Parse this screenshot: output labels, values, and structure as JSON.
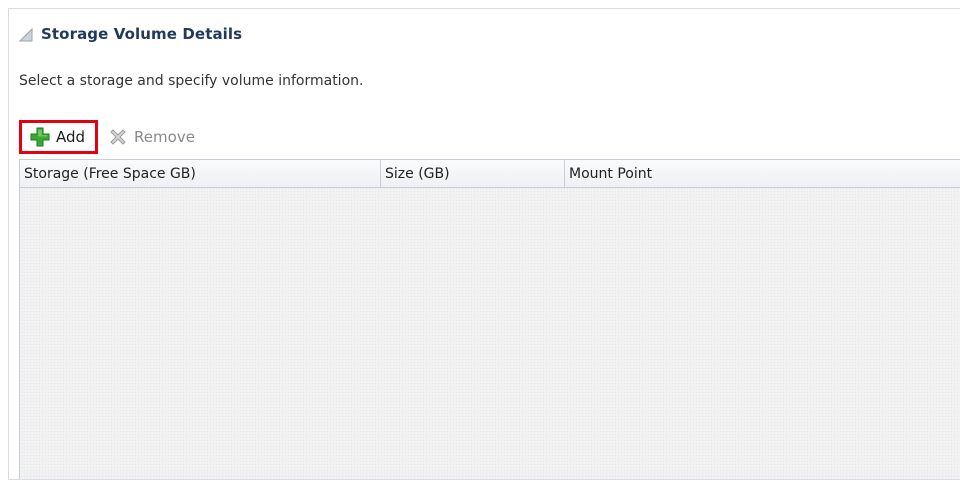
{
  "section": {
    "title": "Storage Volume Details"
  },
  "instruction": "Select a storage and specify volume information.",
  "toolbar": {
    "add_label": "Add",
    "remove_label": "Remove"
  },
  "table": {
    "columns": [
      "Storage (Free Space GB)",
      "Size (GB)",
      "Mount Point"
    ],
    "rows": []
  },
  "colors": {
    "highlight_border": "#e3000f",
    "title_color": "#1f3a5a",
    "add_icon_green": "#3aa832"
  },
  "icons": {
    "disclosure": "disclosure-triangle-icon",
    "add": "plus-icon",
    "remove": "remove-x-icon"
  }
}
